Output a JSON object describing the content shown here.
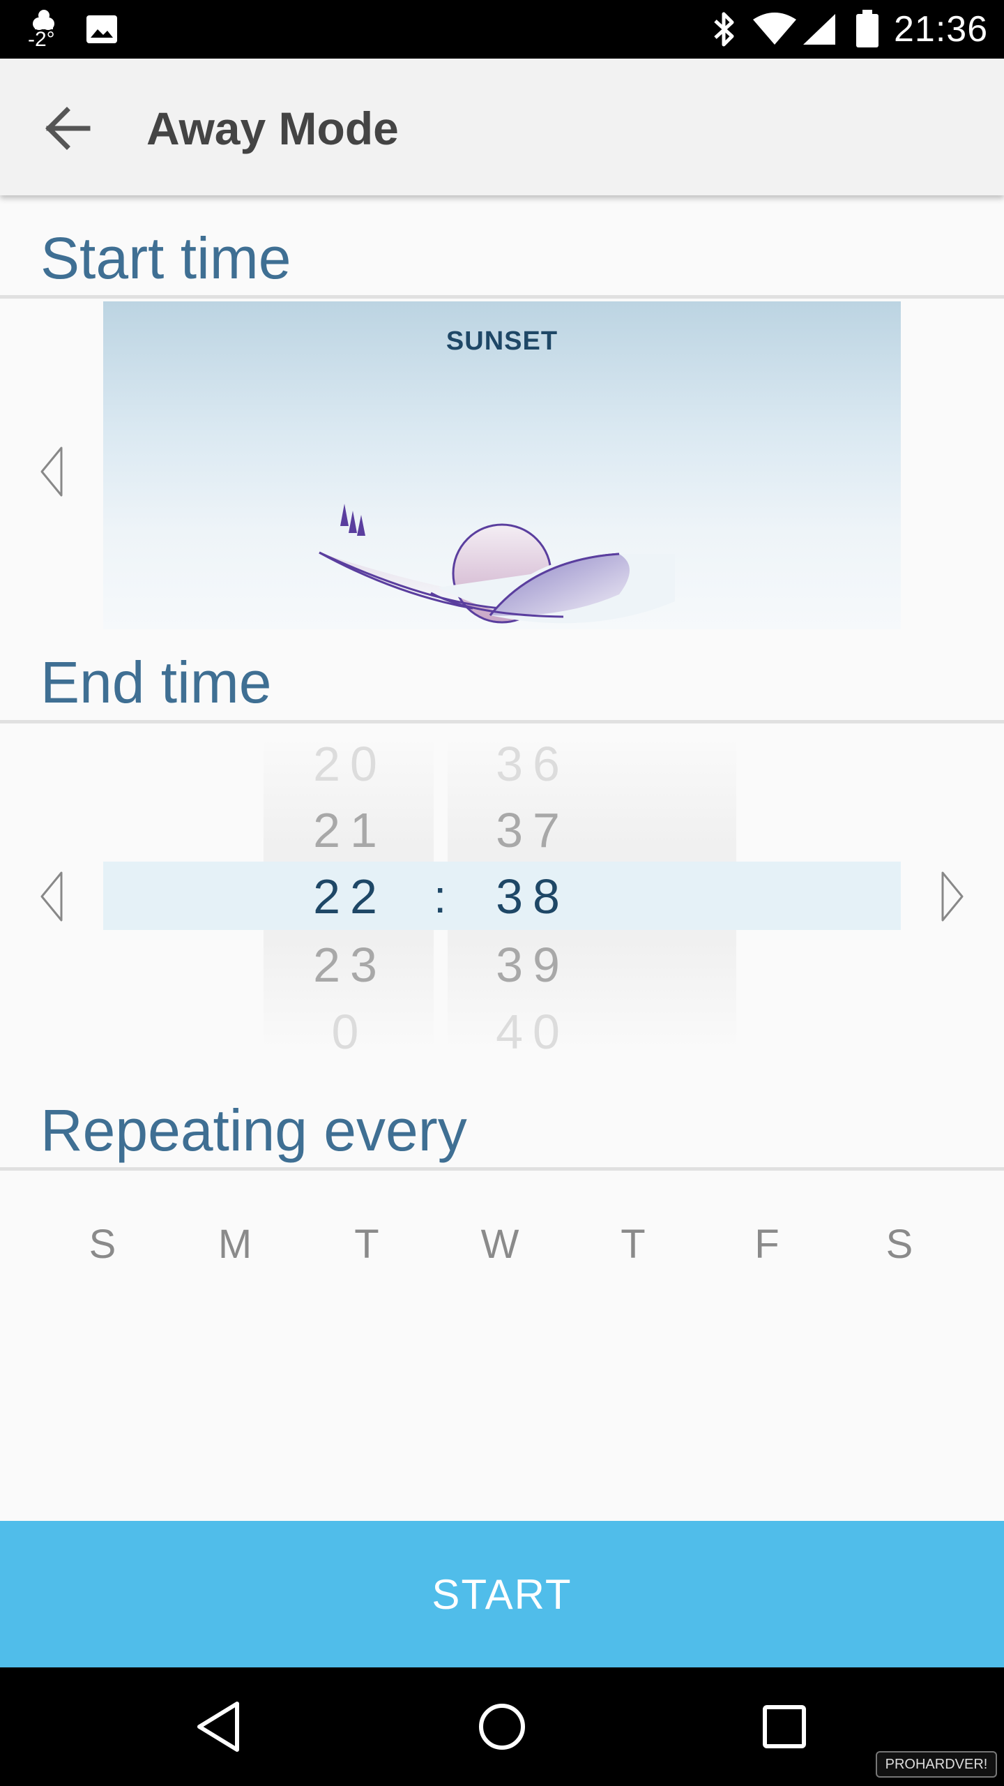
{
  "status_bar": {
    "temperature": "-2°",
    "time": "21:36",
    "battery_level": "89"
  },
  "app_bar": {
    "title": "Away Mode"
  },
  "start_time": {
    "header": "Start time",
    "preset_label": "SUNSET"
  },
  "end_time": {
    "header": "End time",
    "hours": [
      "20",
      "21",
      "22",
      "23",
      "0"
    ],
    "minutes": [
      "36",
      "37",
      "38",
      "39",
      "40"
    ],
    "selected_hour": "22",
    "selected_minute": "38",
    "separator": ":"
  },
  "repeat": {
    "header": "Repeating every",
    "days": [
      "S",
      "M",
      "T",
      "W",
      "T",
      "F",
      "S"
    ]
  },
  "actions": {
    "start_label": "START"
  },
  "watermark": "PROHARDVER!",
  "colors": {
    "accent": "#50bdea",
    "header_text": "#3f6f93",
    "selected_text": "#1e4766",
    "highlight": "#e5f1f7"
  }
}
